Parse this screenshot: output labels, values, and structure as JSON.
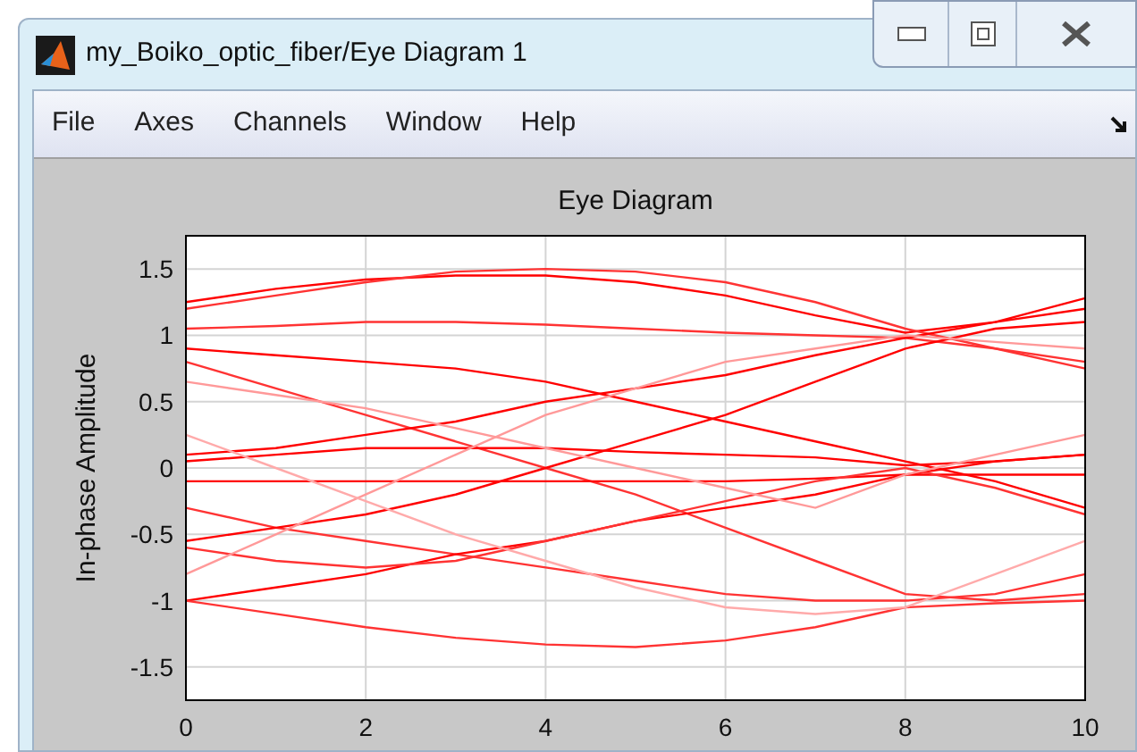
{
  "window": {
    "title": "my_Boiko_optic_fiber/Eye Diagram 1"
  },
  "menu": [
    "File",
    "Axes",
    "Channels",
    "Window",
    "Help"
  ],
  "plot": {
    "chart_data": {
      "type": "line",
      "grid": true,
      "title": "Eye Diagram",
      "ylabel": "In-phase Amplitude",
      "x": [
        0,
        1,
        2,
        3,
        4,
        5,
        6,
        7,
        8,
        9,
        10
      ],
      "xlim": [
        0,
        10
      ],
      "ylim": [
        -1.75,
        1.75
      ],
      "xticks": [
        0,
        2,
        4,
        6,
        8,
        10
      ],
      "yticks": [
        -1.5,
        -1,
        -0.5,
        0,
        0.5,
        1,
        1.5
      ],
      "series": [
        {
          "color": "#ff0000",
          "values": [
            1.25,
            1.35,
            1.42,
            1.45,
            1.45,
            1.4,
            1.3,
            1.15,
            1.02,
            1.1,
            1.28
          ]
        },
        {
          "color": "#ff3333",
          "values": [
            1.2,
            1.3,
            1.4,
            1.48,
            1.5,
            1.48,
            1.4,
            1.25,
            1.05,
            0.9,
            0.75
          ]
        },
        {
          "color": "#ff3333",
          "values": [
            1.05,
            1.07,
            1.1,
            1.1,
            1.08,
            1.05,
            1.02,
            1.0,
            0.98,
            0.9,
            0.8
          ]
        },
        {
          "color": "#ff0000",
          "values": [
            0.9,
            0.85,
            0.8,
            0.75,
            0.65,
            0.5,
            0.35,
            0.2,
            0.05,
            -0.1,
            -0.3
          ]
        },
        {
          "color": "#ff3333",
          "values": [
            0.8,
            0.6,
            0.4,
            0.2,
            0.0,
            -0.2,
            -0.45,
            -0.7,
            -0.95,
            -1.0,
            -0.95
          ]
        },
        {
          "color": "#ff0000",
          "values": [
            0.1,
            0.15,
            0.25,
            0.35,
            0.5,
            0.6,
            0.7,
            0.85,
            0.98,
            1.1,
            1.2
          ]
        },
        {
          "color": "#ff0000",
          "values": [
            0.05,
            0.1,
            0.15,
            0.15,
            0.15,
            0.12,
            0.1,
            0.08,
            0.02,
            0.05,
            0.1
          ]
        },
        {
          "color": "#ff0000",
          "values": [
            -0.1,
            -0.1,
            -0.1,
            -0.1,
            -0.1,
            -0.1,
            -0.1,
            -0.08,
            -0.05,
            -0.05,
            -0.05
          ]
        },
        {
          "color": "#ff3333",
          "values": [
            -0.3,
            -0.45,
            -0.55,
            -0.65,
            -0.75,
            -0.85,
            -0.95,
            -1.0,
            -1.0,
            -0.95,
            -0.8
          ]
        },
        {
          "color": "#ff0000",
          "values": [
            -0.55,
            -0.45,
            -0.35,
            -0.2,
            0.0,
            0.2,
            0.4,
            0.65,
            0.9,
            1.05,
            1.1
          ]
        },
        {
          "color": "#ff0000",
          "values": [
            -1.0,
            -0.9,
            -0.8,
            -0.65,
            -0.55,
            -0.4,
            -0.3,
            -0.2,
            -0.05,
            0.05,
            0.1
          ]
        },
        {
          "color": "#ff3333",
          "values": [
            -1.0,
            -1.1,
            -1.2,
            -1.28,
            -1.33,
            -1.35,
            -1.3,
            -1.2,
            -1.05,
            -1.02,
            -1.0
          ]
        },
        {
          "color": "#ff3333",
          "values": [
            -0.6,
            -0.7,
            -0.75,
            -0.7,
            -0.55,
            -0.4,
            -0.25,
            -0.1,
            0.0,
            -0.15,
            -0.35
          ]
        },
        {
          "color": "#ff9999",
          "values": [
            0.65,
            0.55,
            0.45,
            0.3,
            0.15,
            0.0,
            -0.15,
            -0.3,
            -0.05,
            0.1,
            0.25
          ]
        },
        {
          "color": "#ff9999",
          "values": [
            -0.8,
            -0.5,
            -0.2,
            0.1,
            0.4,
            0.6,
            0.8,
            0.9,
            1.0,
            0.95,
            0.9
          ]
        },
        {
          "color": "#ffaaaa",
          "values": [
            0.25,
            0.0,
            -0.25,
            -0.5,
            -0.7,
            -0.9,
            -1.05,
            -1.1,
            -1.05,
            -0.8,
            -0.55
          ]
        }
      ]
    }
  }
}
